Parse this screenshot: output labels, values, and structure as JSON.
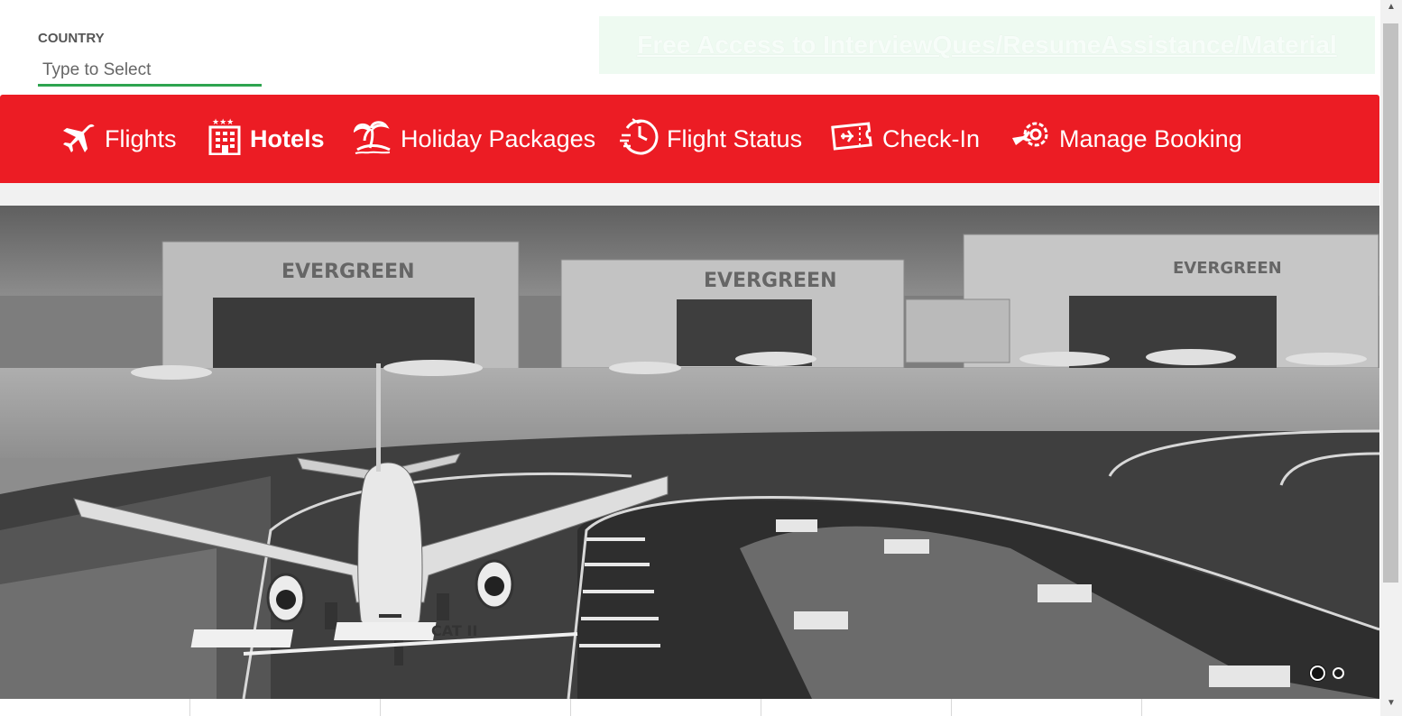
{
  "country": {
    "label": "COUNTRY",
    "placeholder": "Type to Select"
  },
  "promo": {
    "text": "Free Access to InterviewQues/ResumeAssistance/Material"
  },
  "nav": {
    "items": [
      {
        "label": "Flights",
        "icon": "airplane-icon"
      },
      {
        "label": "Hotels",
        "icon": "hotel-icon",
        "active": true
      },
      {
        "label": "Holiday Packages",
        "icon": "palm-island-icon"
      },
      {
        "label": "Flight Status",
        "icon": "clock-plane-icon"
      },
      {
        "label": "Check-In",
        "icon": "ticket-icon"
      },
      {
        "label": "Manage Booking",
        "icon": "gear-plane-icon"
      }
    ]
  },
  "hero": {
    "hangar_signs": [
      "EVERGREEN",
      "EVERGREEN",
      "EVERGREEN"
    ],
    "runway_marking": "CAT II"
  },
  "carousel": {
    "slide_count": 2,
    "active_index": 0
  },
  "colors": {
    "brand_red": "#ec1c24",
    "input_underline": "#2ea44f",
    "promo_bg": "#eefaf1"
  }
}
